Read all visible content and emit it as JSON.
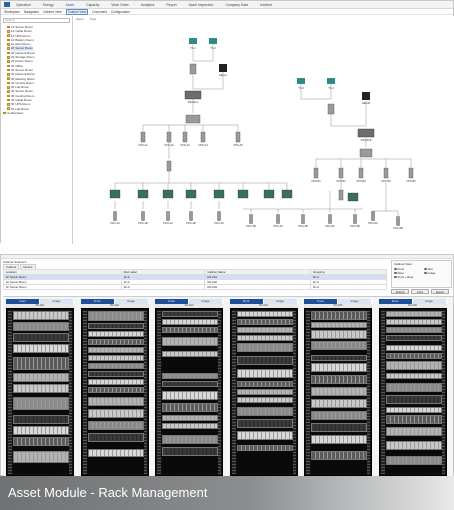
{
  "menu": {
    "items": [
      "Operation",
      "Energy",
      "Asset",
      "Capacity",
      "Work Order",
      "Analytics",
      "Report",
      "Asset Inspection",
      "Company Data",
      "Incident"
    ],
    "active_index": 2
  },
  "subnav": {
    "items": [
      "Workspace",
      "Navigation",
      "Cabinet View",
      "Custom View",
      "Document",
      "Configuration"
    ],
    "selected_index": 3
  },
  "tree": {
    "search_placeholder": "Search",
    "nodes": [
      "1F Server Room",
      "1F Cable Room",
      "1F UPS Room",
      "1F Battery Room",
      "1F AHU Room",
      "2F Server Room",
      "2F Network Room",
      "2F Storage Room",
      "2F Power Room",
      "2F Office",
      "3F Server Room",
      "3F Network Room",
      "3F Meeting Room",
      "3F Control Room",
      "3F Lab Room",
      "4F Server Room",
      "4F Cooling Room",
      "4F Cable Room",
      "5F UPS Room",
      "5F Lab Room",
      "Unallocated"
    ],
    "selected_index": 5
  },
  "canvas": {
    "tabs": [
      "Zoom",
      "Type"
    ],
    "topology_labels": {
      "transformers": [
        "TX-1",
        "TX-2",
        "TX-3",
        "TX-4"
      ],
      "generators": [
        "GEN-A",
        "GEN-B"
      ],
      "switchgear": [
        "SWGR-A",
        "SWGR-B"
      ],
      "ups": [
        "UPS-A1",
        "UPS-A2",
        "UPS-A3",
        "UPS-A4",
        "UPS-A5",
        "UPS-B1",
        "UPS-B2",
        "UPS-B3",
        "UPS-B4",
        "UPS-B5"
      ],
      "pdus": [
        "PDU-1A",
        "PDU-1B",
        "PDU-2A",
        "PDU-2B",
        "PDU-3A",
        "PDU-3B",
        "PDU-4A",
        "PDU-4B",
        "PDU-5A",
        "PDU-5B",
        "PDU-6A",
        "PDU-6B"
      ]
    }
  },
  "rack_view": {
    "section_title": "Cabinet Selection",
    "tabs": [
      "Cabinet",
      "Device"
    ],
    "columns": [
      "Location",
      "Row Label",
      "Cabinet Name",
      "Grouping"
    ],
    "rows": [
      [
        "1F Server Room",
        "1F-A",
        "R2-A01",
        "1F-A"
      ],
      [
        "1F Server Room",
        "1F-A",
        "R2-A02",
        "1F-A"
      ],
      [
        "1F Server Room",
        "1F-A",
        "R2-A03",
        "1F-A"
      ]
    ],
    "view_box_title": "Cabinet View",
    "view_options": [
      "Front",
      "Rear",
      "Front + Rear",
      "Text",
      "Image"
    ],
    "buttons": [
      "Submit",
      "Find",
      "Export"
    ],
    "racks": [
      {
        "front_label": "Front",
        "rear_label": "Image",
        "name": "R2-A01"
      },
      {
        "front_label": "Front",
        "rear_label": "Image",
        "name": "R2-A02"
      },
      {
        "front_label": "Front",
        "rear_label": "Image",
        "name": "R2-A03"
      },
      {
        "front_label": "Front",
        "rear_label": "Image",
        "name": "R2-A04"
      },
      {
        "front_label": "Front",
        "rear_label": "Image",
        "name": "R2-A05"
      },
      {
        "front_label": "Front",
        "rear_label": "Image",
        "name": "R2-A06"
      }
    ]
  },
  "caption": "Asset Module - Rack Management"
}
